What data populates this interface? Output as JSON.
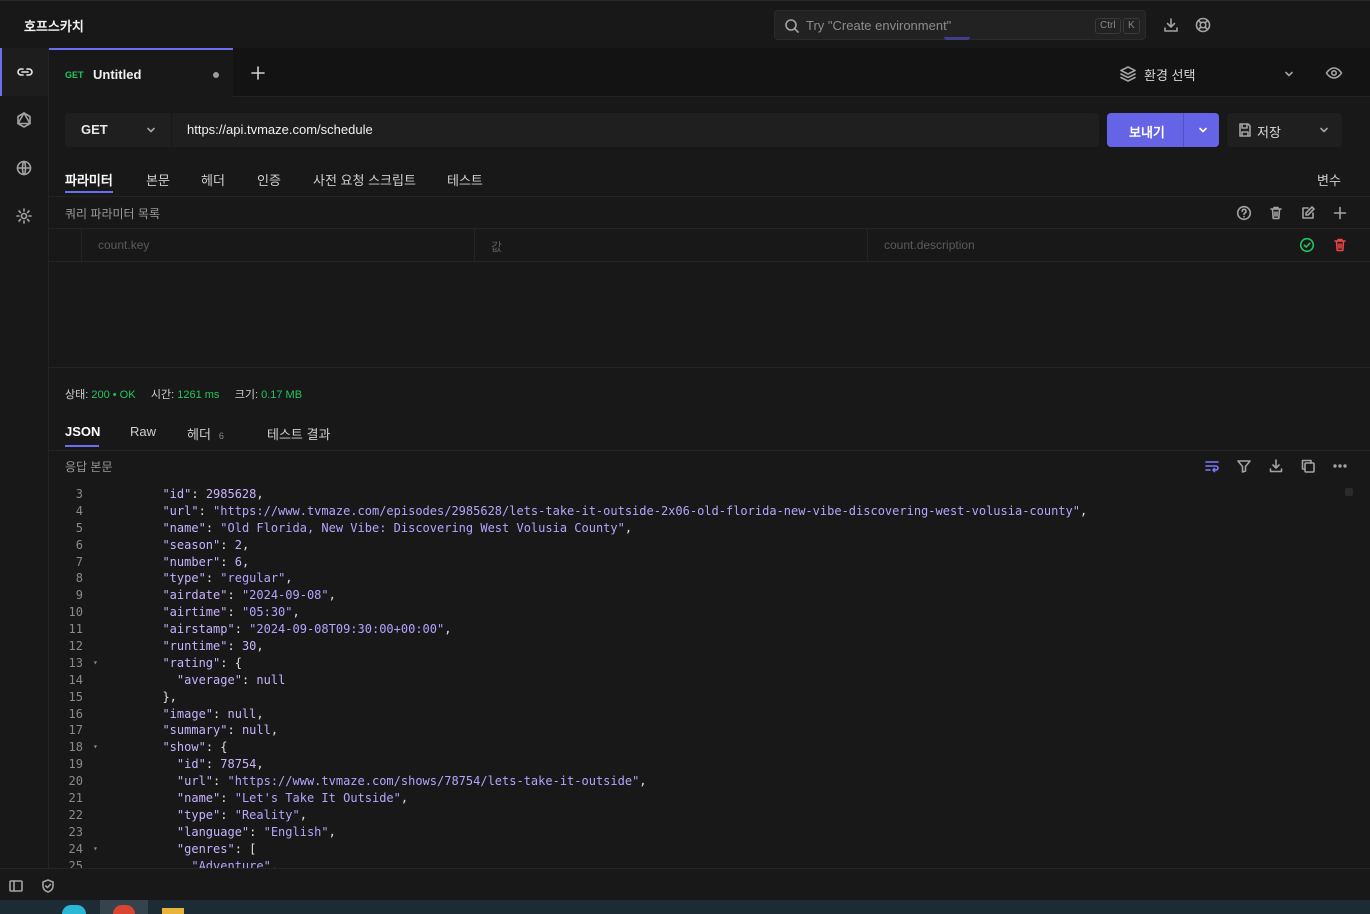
{
  "app": {
    "title": "호프스카치"
  },
  "search": {
    "placeholder": "Try \"Create environment\"",
    "kbd1": "Ctrl",
    "kbd2": "K"
  },
  "tab": {
    "method": "GET",
    "title": "Untitled"
  },
  "environment": {
    "label": "환경 선택"
  },
  "request": {
    "method": "GET",
    "url": "https://api.tvmaze.com/schedule",
    "send_label": "보내기",
    "save_label": "저장",
    "tabs": [
      "파라미터",
      "본문",
      "헤더",
      "인증",
      "사전 요청 스크립트",
      "테스트"
    ],
    "variables_label": "변수",
    "params_title": "쿼리 파라미터 목록",
    "param_key_placeholder": "count.key",
    "param_value_placeholder": "값",
    "param_desc_placeholder": "count.description"
  },
  "status": {
    "status_label": "상태:",
    "status_value": "200 • OK",
    "time_label": "시간:",
    "time_value": "1261 ms",
    "size_label": "크기:",
    "size_value": "0.17 MB"
  },
  "response": {
    "tabs": [
      "JSON",
      "Raw",
      "헤더",
      "테스트 결과"
    ],
    "header_count": "6",
    "body_title": "응답 본문",
    "lines": [
      {
        "n": "3",
        "indent": 1,
        "key": "id",
        "val": "2985628",
        "type": "num",
        "end": ","
      },
      {
        "n": "4",
        "indent": 1,
        "key": "url",
        "val": "\"https://www.tvmaze.com/episodes/2985628/lets-take-it-outside-2x06-old-florida-new-vibe-discovering-west-volusia-county\"",
        "type": "str",
        "end": ","
      },
      {
        "n": "5",
        "indent": 1,
        "key": "name",
        "val": "\"Old Florida, New Vibe: Discovering West Volusia County\"",
        "type": "str",
        "end": ","
      },
      {
        "n": "6",
        "indent": 1,
        "key": "season",
        "val": "2",
        "type": "num",
        "end": ","
      },
      {
        "n": "7",
        "indent": 1,
        "key": "number",
        "val": "6",
        "type": "num",
        "end": ","
      },
      {
        "n": "8",
        "indent": 1,
        "key": "type",
        "val": "\"regular\"",
        "type": "str",
        "end": ","
      },
      {
        "n": "9",
        "indent": 1,
        "key": "airdate",
        "val": "\"2024-09-08\"",
        "type": "str",
        "end": ","
      },
      {
        "n": "10",
        "indent": 1,
        "key": "airtime",
        "val": "\"05:30\"",
        "type": "str",
        "end": ","
      },
      {
        "n": "11",
        "indent": 1,
        "key": "airstamp",
        "val": "\"2024-09-08T09:30:00+00:00\"",
        "type": "str",
        "end": ","
      },
      {
        "n": "12",
        "indent": 1,
        "key": "runtime",
        "val": "30",
        "type": "num",
        "end": ","
      },
      {
        "n": "13",
        "indent": 1,
        "key": "rating",
        "val": "{",
        "type": "punct",
        "end": "",
        "fold": true
      },
      {
        "n": "14",
        "indent": 2,
        "key": "average",
        "val": "null",
        "type": "num",
        "end": ""
      },
      {
        "n": "15",
        "indent": 1,
        "key": "",
        "val": "},",
        "type": "punct",
        "end": ""
      },
      {
        "n": "16",
        "indent": 1,
        "key": "image",
        "val": "null",
        "type": "num",
        "end": ","
      },
      {
        "n": "17",
        "indent": 1,
        "key": "summary",
        "val": "null",
        "type": "num",
        "end": ","
      },
      {
        "n": "18",
        "indent": 1,
        "key": "show",
        "val": "{",
        "type": "punct",
        "end": "",
        "fold": true
      },
      {
        "n": "19",
        "indent": 2,
        "key": "id",
        "val": "78754",
        "type": "num",
        "end": ","
      },
      {
        "n": "20",
        "indent": 2,
        "key": "url",
        "val": "\"https://www.tvmaze.com/shows/78754/lets-take-it-outside\"",
        "type": "str",
        "end": ","
      },
      {
        "n": "21",
        "indent": 2,
        "key": "name",
        "val": "\"Let's Take It Outside\"",
        "type": "str",
        "end": ","
      },
      {
        "n": "22",
        "indent": 2,
        "key": "type",
        "val": "\"Reality\"",
        "type": "str",
        "end": ","
      },
      {
        "n": "23",
        "indent": 2,
        "key": "language",
        "val": "\"English\"",
        "type": "str",
        "end": ","
      },
      {
        "n": "24",
        "indent": 2,
        "key": "genres",
        "val": "[",
        "type": "punct",
        "end": "",
        "fold": true
      },
      {
        "n": "25",
        "indent": 3,
        "key": "",
        "val": "\"Adventure\",",
        "type": "str",
        "end": ""
      }
    ]
  },
  "colors": {
    "accent": "#6563e6",
    "success": "#22c55e",
    "danger": "#ef4444",
    "json_key": "#c7b3ff"
  }
}
